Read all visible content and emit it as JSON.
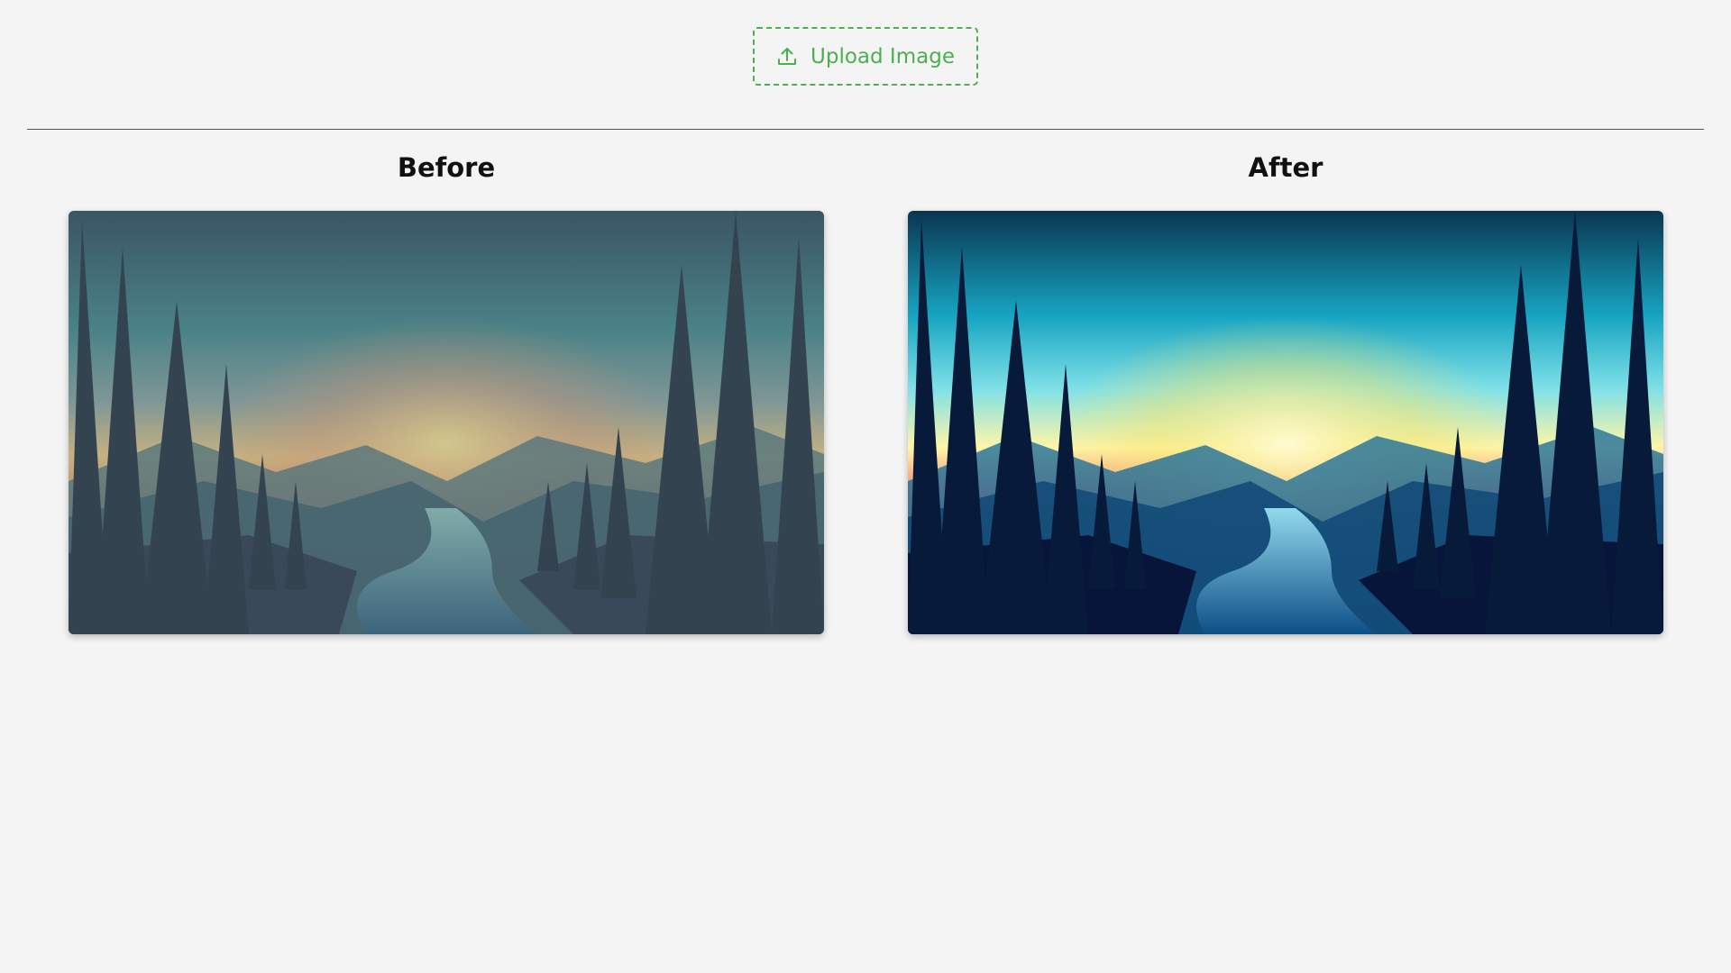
{
  "upload": {
    "label": "Upload Image",
    "icon": "upload-icon"
  },
  "panels": {
    "before": {
      "title": "Before"
    },
    "after": {
      "title": "After"
    }
  },
  "colors": {
    "accent": "#4caf50",
    "background": "#f4f4f4",
    "divider": "#555555"
  }
}
